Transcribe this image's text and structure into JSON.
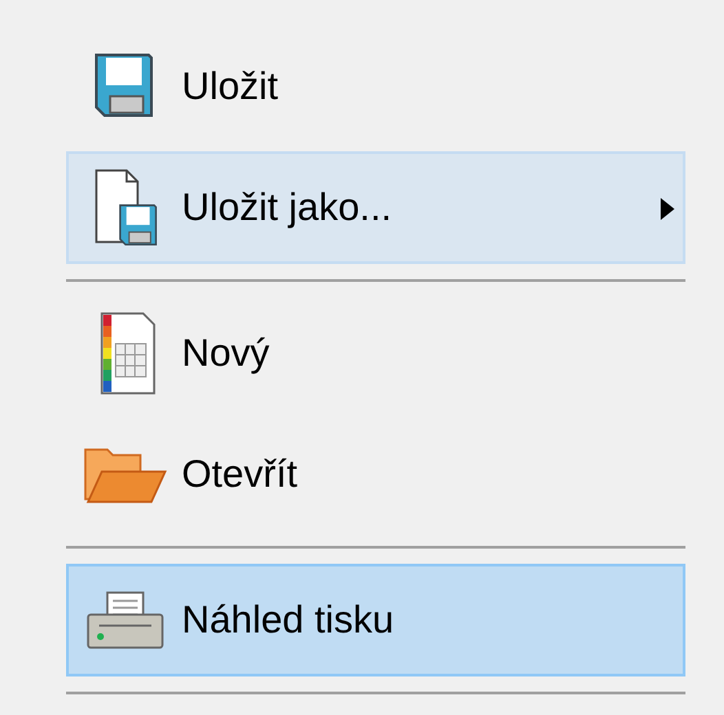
{
  "menu": {
    "items": [
      {
        "kind": "item",
        "label": "Uložit",
        "selected": false,
        "hovered": false,
        "submenu": false
      },
      {
        "kind": "item",
        "label": "Uložit jako...",
        "selected": false,
        "hovered": true,
        "submenu": true
      },
      {
        "kind": "separator"
      },
      {
        "kind": "item",
        "label": "Nový",
        "selected": false,
        "hovered": false,
        "submenu": false
      },
      {
        "kind": "item",
        "label": "Otevřít",
        "selected": false,
        "hovered": false,
        "submenu": false
      },
      {
        "kind": "separator"
      },
      {
        "kind": "item",
        "label": "Náhled tisku",
        "selected": true,
        "hovered": false,
        "submenu": false
      },
      {
        "kind": "separator"
      }
    ]
  }
}
